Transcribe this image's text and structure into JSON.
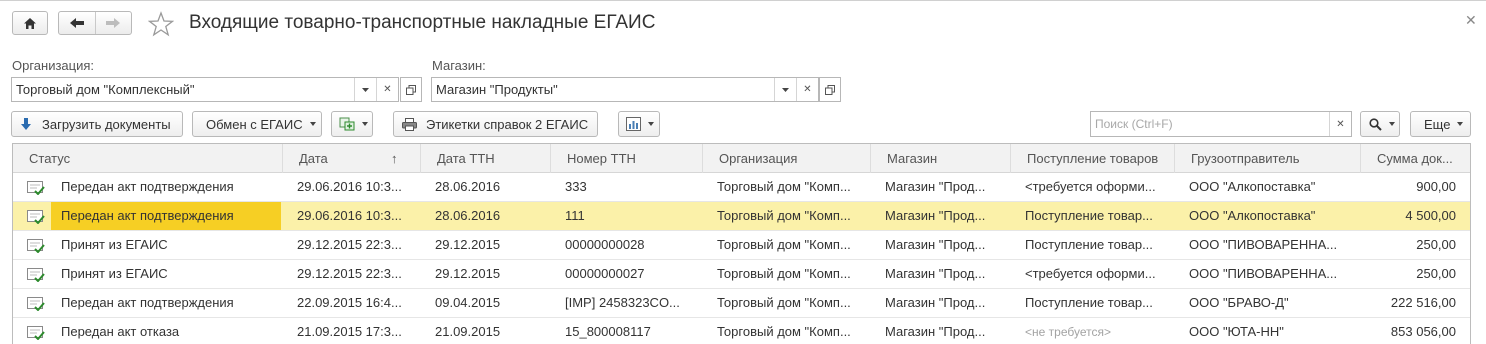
{
  "title": "Входящие товарно-транспортные накладные ЕГАИС",
  "filters": {
    "organization": {
      "label": "Организация:",
      "value": "Торговый дом \"Комплексный\""
    },
    "store": {
      "label": "Магазин:",
      "value": "Магазин \"Продукты\""
    }
  },
  "toolbar": {
    "load_label": "Загрузить документы",
    "exchange_label": "Обмен с ЕГАИС",
    "labels_label": "Этикетки справок 2 ЕГАИС",
    "search_placeholder": "Поиск (Ctrl+F)",
    "more_label": "Еще"
  },
  "table": {
    "columns": [
      "Статус",
      "Дата",
      "Дата ТТН",
      "Номер ТТН",
      "Организация",
      "Магазин",
      "Поступление товаров",
      "Грузоотправитель",
      "Сумма док..."
    ],
    "sort_indicator": "↑",
    "rows": [
      [
        "Передан акт подтверждения",
        "29.06.2016 10:3...",
        "28.06.2016",
        "333",
        "Торговый дом \"Комп...",
        "Магазин \"Прод...",
        "<требуется оформи...",
        "ООО \"Алкопоставка\"",
        "900,00"
      ],
      [
        "Передан акт подтверждения",
        "29.06.2016 10:3...",
        "28.06.2016",
        "111",
        "Торговый дом \"Комп...",
        "Магазин \"Прод...",
        "Поступление товар...",
        "ООО \"Алкопоставка\"",
        "4 500,00"
      ],
      [
        "Принят из ЕГАИС",
        "29.12.2015 22:3...",
        "29.12.2015",
        "00000000028",
        "Торговый дом \"Комп...",
        "Магазин \"Прод...",
        "Поступление товар...",
        "ООО \"ПИВОВАРЕННА...",
        "250,00"
      ],
      [
        "Принят из ЕГАИС",
        "29.12.2015 22:3...",
        "29.12.2015",
        "00000000027",
        "Торговый дом \"Комп...",
        "Магазин \"Прод...",
        "<требуется оформи...",
        "ООО \"ПИВОВАРЕННА...",
        "250,00"
      ],
      [
        "Передан акт подтверждения",
        "22.09.2015 16:4...",
        "09.04.2015",
        "[IMP] 2458323CO...",
        "Торговый дом \"Комп...",
        "Магазин \"Прод...",
        "Поступление товар...",
        "ООО \"БРАВО-Д\"",
        "222 516,00"
      ],
      [
        "Передан акт отказа",
        "21.09.2015 17:3...",
        "21.09.2015",
        "15_800008117",
        "Торговый дом \"Комп...",
        "Магазин \"Прод...",
        "<не требуется>",
        "ООО \"ЮТА-НН\"",
        "853 056,00"
      ]
    ],
    "selected_row": 1,
    "muted_cells": [
      [
        5,
        6
      ]
    ]
  },
  "colors": {
    "selected_row": "#fbf1a9",
    "selected_cell": "#f6cf24",
    "accent_icon": "#2c8a2c"
  }
}
